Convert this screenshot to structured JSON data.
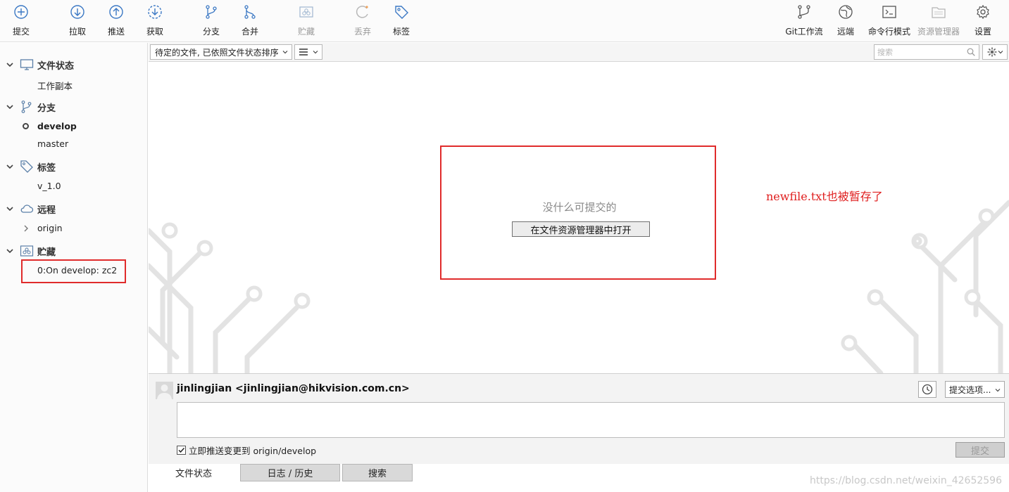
{
  "toolbar": {
    "commit": "提交",
    "pull": "拉取",
    "push": "推送",
    "fetch": "获取",
    "branch": "分支",
    "merge": "合并",
    "stash": "贮藏",
    "discard": "丢弃",
    "tag": "标签",
    "git_flow": "Git工作流",
    "remote": "远端",
    "terminal": "命令行模式",
    "explorer": "资源管理器",
    "settings": "设置"
  },
  "sidebar": {
    "file_status": "文件状态",
    "working_copy": "工作副本",
    "branches": "分支",
    "branch_develop": "develop",
    "branch_master": "master",
    "tags": "标签",
    "tag_v1": "v_1.0",
    "remotes": "远程",
    "remote_origin": "origin",
    "stashes": "贮藏",
    "stash_0": "0:On develop: zc2"
  },
  "filter": {
    "sort_label": "待定的文件, 已依照文件状态排序",
    "search_placeholder": "搜索"
  },
  "content": {
    "empty_text": "没什么可提交的",
    "open_explorer": "在文件资源管理器中打开",
    "annotation": "newfile.txt也被暂存了"
  },
  "commit": {
    "author": "jinlingjian <jinlingjian@hikvision.com.cn>",
    "options": "提交选项...",
    "push_label": "立即推送变更到 origin/develop",
    "push_checked": true,
    "commit_button": "提交"
  },
  "tabs": {
    "file_status": "文件状态",
    "log_history": "日志 / 历史",
    "search": "搜索"
  },
  "watermark": "https://blog.csdn.net/weixin_42652596",
  "colors": {
    "accent": "#3b78c4",
    "highlight_red": "#e02b2b"
  }
}
